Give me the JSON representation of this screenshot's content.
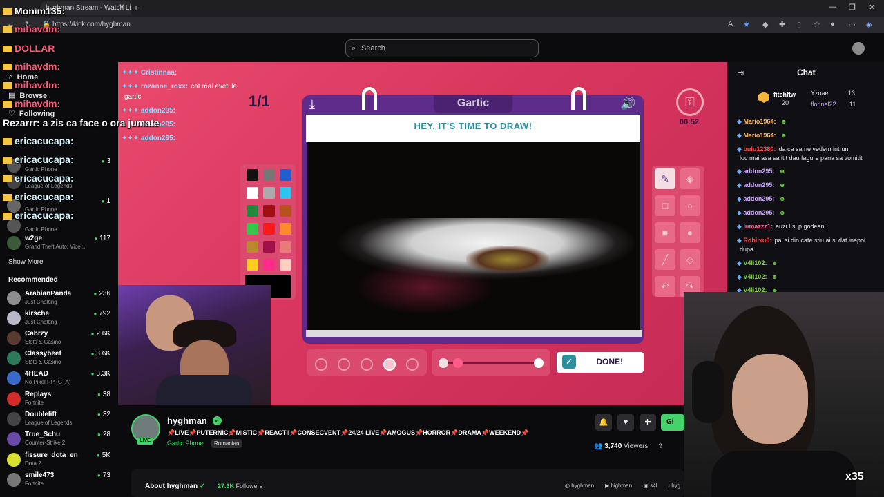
{
  "browser": {
    "tab_title": "hyghman Stream - Watch Li",
    "url": "https://kick.com/hyghman",
    "win_min": "—",
    "win_max": "❐",
    "win_close": "✕"
  },
  "header": {
    "search_placeholder": "Search"
  },
  "sidebar": {
    "nav": [
      {
        "icon": "home-icon",
        "label": "Home"
      },
      {
        "icon": "browse-icon",
        "label": "Browse"
      },
      {
        "icon": "heart-icon",
        "label": "Following"
      }
    ],
    "following": [
      {
        "name": "",
        "game": "Gartic Phone",
        "count": "3"
      },
      {
        "name": "",
        "game": "League of Legends",
        "count": ""
      },
      {
        "name": "",
        "game": "Gartic Phone",
        "count": "1"
      },
      {
        "name": "",
        "game": "Gartic Phone",
        "count": ""
      },
      {
        "name": "w2ge",
        "game": "Grand Theft Auto: Vice...",
        "count": "117"
      }
    ],
    "show_more": "Show More",
    "recommended_title": "Recommended",
    "recommended": [
      {
        "name": "ArabianPanda",
        "game": "Just Chatting",
        "count": "236",
        "color": "#8d8d8d"
      },
      {
        "name": "kirsche",
        "game": "Just Chatting",
        "count": "792",
        "color": "#b8b8c8"
      },
      {
        "name": "Cabrzy",
        "game": "Slots & Casino",
        "count": "2.6K",
        "color": "#5a3a30"
      },
      {
        "name": "Classybeef",
        "game": "Slots & Casino",
        "count": "3.6K",
        "color": "#2c7a5a"
      },
      {
        "name": "4HEAD",
        "game": "No Pixel RP (GTA)",
        "count": "3.3K",
        "color": "#3a6ac8"
      },
      {
        "name": "Replays",
        "game": "Fortnite",
        "count": "38",
        "color": "#d32a2a"
      },
      {
        "name": "Doublelift",
        "game": "League of Legends",
        "count": "32",
        "color": "#444"
      },
      {
        "name": "True_Schu",
        "game": "Counter-Strike 2",
        "count": "28",
        "color": "#6a4aa8"
      },
      {
        "name": "fissure_dota_en",
        "game": "Dota 2",
        "count": "5K",
        "color": "#d8e030"
      },
      {
        "name": "smile473",
        "game": "Fortnite",
        "count": "73",
        "color": "#777"
      }
    ]
  },
  "overlay_chat": [
    {
      "text": "Monim135:",
      "cls": "white"
    },
    {
      "text": "mihavdm:",
      "cls": ""
    },
    {
      "text": "DOLLAR",
      "cls": ""
    },
    {
      "text": "mihavdm:",
      "cls": ""
    },
    {
      "text": "mihavdm:",
      "cls": ""
    },
    {
      "text": "mihavdm:",
      "cls": ""
    },
    {
      "text": "Rezarrr: a zis ca face o ora jumate",
      "cls": "white"
    },
    {
      "text": "ericacucapa:",
      "cls": "cyan"
    },
    {
      "text": "ericacucapa:",
      "cls": "cyan"
    },
    {
      "text": "ericacucapa:",
      "cls": "cyan"
    },
    {
      "text": "ericacucapa:",
      "cls": "cyan"
    },
    {
      "text": "ericacucapa:",
      "cls": "cyan"
    }
  ],
  "game": {
    "brand": "Gartic",
    "instruction": "HEY, IT'S TIME TO DRAW!",
    "round": "1/1",
    "timer": "00:52",
    "done_label": "DONE!",
    "chat": [
      {
        "user": "Cristinnaa:",
        "msg": ""
      },
      {
        "user": "rozanne_roxx:",
        "msg": "cat mai aveti la"
      },
      {
        "user": "",
        "msg": "gartic"
      },
      {
        "user": "addon295:",
        "msg": ""
      },
      {
        "user": "addon295:",
        "msg": ""
      },
      {
        "user": "addon295:",
        "msg": ""
      }
    ],
    "palette": [
      "#111111",
      "#777777",
      "#1f5fd1",
      "#ffffff",
      "#aaaaaa",
      "#2ec4f0",
      "#1e8a3a",
      "#a01010",
      "#b8521a",
      "#32c84a",
      "#ff1a1a",
      "#ff8a2a",
      "#b88a2a",
      "#a0104a",
      "#e87a7a",
      "#ffcc22",
      "#ff2a8a",
      "#ffd0c0"
    ]
  },
  "chat": {
    "title": "Chat",
    "gifters": [
      {
        "name": "fitchftw",
        "count": "20"
      },
      {
        "name": "Yzoae",
        "count": "13"
      },
      {
        "name": "florinel22",
        "count": "11"
      }
    ],
    "messages": [
      {
        "user": "Mario1964:",
        "msg": "",
        "cls": "u-orange"
      },
      {
        "user": "Mario1964:",
        "msg": "",
        "cls": "u-orange"
      },
      {
        "user": "bulu12380:",
        "msg": "da ca sa ne vedem intrun",
        "cls": "u-red"
      },
      {
        "user": "",
        "msg": "loc mai asa sa itit dau fagure pana sa vomitit",
        "cls": ""
      },
      {
        "user": "addon295:",
        "msg": "",
        "cls": "u-purple"
      },
      {
        "user": "addon295:",
        "msg": "",
        "cls": "u-purple"
      },
      {
        "user": "addon295:",
        "msg": "",
        "cls": "u-purple"
      },
      {
        "user": "addon295:",
        "msg": "",
        "cls": "u-purple"
      },
      {
        "user": "lumazzz1:",
        "msg": "auzi I si p godeanu",
        "cls": "u-pink"
      },
      {
        "user": "Robiixu0:",
        "msg": "pai si din cate stiu ai si dat inapoi",
        "cls": "u-red"
      },
      {
        "user": "",
        "msg": "dupa",
        "cls": ""
      },
      {
        "user": "V4li102:",
        "msg": "",
        "cls": "u-green"
      },
      {
        "user": "V4li102:",
        "msg": "",
        "cls": "u-green"
      },
      {
        "user": "V4li102:",
        "msg": "",
        "cls": "u-green"
      }
    ]
  },
  "stream_info": {
    "name": "hyghman",
    "live": "LIVE",
    "title": "📌LIVE📌PUTERNIC📌MISTIC📌REACTII📌CONSECVENT📌24/24 LIVE📌AMOGUS📌HORROR📌DRAMA📌WEEKEND📌",
    "category": "Gartic Phone",
    "tag": "Romanian",
    "viewers": "3,740",
    "viewers_label": "Viewers",
    "gift_label": "Gi",
    "about": "About hyghman",
    "followers_count": "27.6K",
    "followers_label": "Followers",
    "socials": [
      "hyghman",
      "highman",
      "s4l",
      "hyg"
    ]
  },
  "overlay_multiplier": "x35"
}
